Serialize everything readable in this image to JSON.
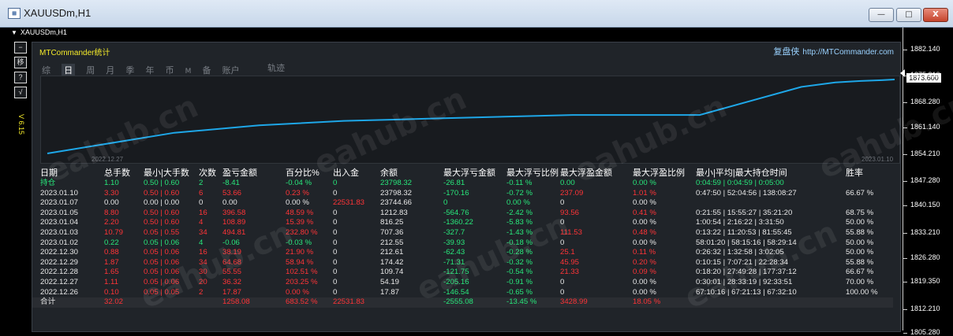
{
  "window": {
    "title": "XAUUSDm,H1",
    "minimize_label": "—",
    "maximize_label": "□",
    "close_label": "X"
  },
  "chart": {
    "symbol_tab": "XAUUSDm,H1",
    "current_price": "1873.600",
    "price_labels": [
      "1882.140",
      "1875.210",
      "1868.280",
      "1861.140",
      "1854.210",
      "1847.280",
      "1840.150",
      "1833.210",
      "1826.280",
      "1819.350",
      "1812.210",
      "1805.280"
    ],
    "left_buttons": [
      "−",
      "移",
      "?",
      "√"
    ],
    "version": "V 6.15"
  },
  "panel": {
    "title": "MTCommander统计",
    "brand_cn": "复盘侠",
    "brand_url": "http://MTCommander.com",
    "tabs": [
      "综",
      "日",
      "周",
      "月",
      "季",
      "年",
      "币",
      "M",
      "备",
      "账户"
    ],
    "active_tab": "日",
    "track_label": "轨迹",
    "equity_start_date": "2022.12.27",
    "equity_end_date": "2023.01.10",
    "equity_curve": [
      0,
      0.28,
      0.38,
      0.44,
      0.47,
      0.5,
      0.52,
      0.52,
      0.52,
      0.9,
      0.96,
      0.98,
      0.99,
      1.0
    ],
    "watermark": "eahub.cn"
  },
  "table": {
    "headers": [
      "日期",
      "总手数",
      "最小|大手数",
      "次数",
      "盈亏金额",
      "百分比%",
      "出入金",
      "余额",
      "最大浮亏金额",
      "最大浮亏比例",
      "最大浮盈金额",
      "最大浮盈比例",
      "最小|平均|最大持仓时间",
      "胜率"
    ],
    "rows": [
      {
        "date": "持仓",
        "lots": "1.10",
        "minmax": "0.50 | 0.60",
        "count": "2",
        "pnl": "-8.41",
        "pct": "-0.04 %",
        "dep": "0",
        "bal": "23798.32",
        "maxloss": "-26.81",
        "maxlosspct": "-0.11 %",
        "maxprofit": "0.00",
        "maxprofitpct": "0.00 %",
        "time": "0:04:59 | 0:04:59 | 0:05:00",
        "win": "",
        "cls": "first"
      },
      {
        "date": "2023.01.10",
        "lots": "3.30",
        "minmax": "0.50 | 0.60",
        "count": "6",
        "pnl": "53.66",
        "pct": "0.23 %",
        "dep": "0",
        "bal": "23798.32",
        "maxloss": "-170.16",
        "maxlosspct": "-0.72 %",
        "maxprofit": "237.09",
        "maxprofitpct": "1.01 %",
        "time": "0:47:50 | 52:04:56 | 138:08:27",
        "win": "66.67 %",
        "cls": "red"
      },
      {
        "date": "2023.01.07",
        "lots": "0.00",
        "minmax": "0.00 | 0.00",
        "count": "0",
        "pnl": "0.00",
        "pct": "0.00 %",
        "dep": "22531.83",
        "bal": "23744.66",
        "maxloss": "0",
        "maxlosspct": "0.00 %",
        "maxprofit": "0",
        "maxprofitpct": "0.00 %",
        "time": "",
        "win": "",
        "cls": "zero"
      },
      {
        "date": "2023.01.05",
        "lots": "8.80",
        "minmax": "0.50 | 0.60",
        "count": "16",
        "pnl": "396.58",
        "pct": "48.59 %",
        "dep": "0",
        "bal": "1212.83",
        "maxloss": "-564.76",
        "maxlosspct": "-2.42 %",
        "maxprofit": "93.56",
        "maxprofitpct": "0.41 %",
        "time": "0:21:55 | 15:55:27 | 35:21:20",
        "win": "68.75 %",
        "cls": "red"
      },
      {
        "date": "2023.01.04",
        "lots": "2.20",
        "minmax": "0.50 | 0.60",
        "count": "4",
        "pnl": "108.89",
        "pct": "15.39 %",
        "dep": "0",
        "bal": "816.25",
        "maxloss": "-1360.22",
        "maxlosspct": "-5.83 %",
        "maxprofit": "0",
        "maxprofitpct": "0.00 %",
        "time": "1:00:54 | 2:16:22 | 3:31:50",
        "win": "50.00 %",
        "cls": "red"
      },
      {
        "date": "2023.01.03",
        "lots": "10.79",
        "minmax": "0.05 | 0.55",
        "count": "34",
        "pnl": "494.81",
        "pct": "232.80 %",
        "dep": "0",
        "bal": "707.36",
        "maxloss": "-327.7",
        "maxlosspct": "-1.43 %",
        "maxprofit": "111.53",
        "maxprofitpct": "0.48 %",
        "time": "0:13:22 | 11:20:53 | 81:55:45",
        "win": "55.88 %",
        "cls": "red"
      },
      {
        "date": "2023.01.02",
        "lots": "0.22",
        "minmax": "0.05 | 0.06",
        "count": "4",
        "pnl": "-0.06",
        "pct": "-0.03 %",
        "dep": "0",
        "bal": "212.55",
        "maxloss": "-39.93",
        "maxlosspct": "-0.18 %",
        "maxprofit": "0",
        "maxprofitpct": "0.00 %",
        "time": "58:01:20 | 58:15:16 | 58:29:14",
        "win": "50.00 %",
        "cls": "green"
      },
      {
        "date": "2022.12.30",
        "lots": "0.88",
        "minmax": "0.05 | 0.06",
        "count": "16",
        "pnl": "38.19",
        "pct": "21.90 %",
        "dep": "0",
        "bal": "212.61",
        "maxloss": "-62.43",
        "maxlosspct": "-0.28 %",
        "maxprofit": "25.1",
        "maxprofitpct": "0.11 %",
        "time": "0:26:32 | 1:32:58 | 3:02:05",
        "win": "50.00 %",
        "cls": "red"
      },
      {
        "date": "2022.12.29",
        "lots": "1.87",
        "minmax": "0.05 | 0.06",
        "count": "34",
        "pnl": "64.68",
        "pct": "58.94 %",
        "dep": "0",
        "bal": "174.42",
        "maxloss": "-71.31",
        "maxlosspct": "-0.32 %",
        "maxprofit": "45.95",
        "maxprofitpct": "0.20 %",
        "time": "0:10:15 | 7:07:21 | 22:28:34",
        "win": "55.88 %",
        "cls": "red"
      },
      {
        "date": "2022.12.28",
        "lots": "1.65",
        "minmax": "0.05 | 0.06",
        "count": "30",
        "pnl": "55.55",
        "pct": "102.51 %",
        "dep": "0",
        "bal": "109.74",
        "maxloss": "-121.75",
        "maxlosspct": "-0.54 %",
        "maxprofit": "21.33",
        "maxprofitpct": "0.09 %",
        "time": "0:18:20 | 27:49:28 | 177:37:12",
        "win": "66.67 %",
        "cls": "red"
      },
      {
        "date": "2022.12.27",
        "lots": "1.11",
        "minmax": "0.05 | 0.06",
        "count": "20",
        "pnl": "36.32",
        "pct": "203.25 %",
        "dep": "0",
        "bal": "54.19",
        "maxloss": "-205.16",
        "maxlosspct": "-0.91 %",
        "maxprofit": "0",
        "maxprofitpct": "0.00 %",
        "time": "0:30:01 | 28:33:19 | 92:33:51",
        "win": "70.00 %",
        "cls": "red"
      },
      {
        "date": "2022.12.26",
        "lots": "0.10",
        "minmax": "0.05 | 0.05",
        "count": "2",
        "pnl": "17.87",
        "pct": "0.00 %",
        "dep": "0",
        "bal": "17.87",
        "maxloss": "-146.54",
        "maxlosspct": "-0.65 %",
        "maxprofit": "0",
        "maxprofitpct": "0.00 %",
        "time": "67:10:16 | 67:21:13 | 67:32:10",
        "win": "100.00 %",
        "cls": "red"
      }
    ],
    "total": {
      "date": "合计",
      "lots": "32.02",
      "minmax": "",
      "count": "",
      "pnl": "1258.08",
      "pct": "683.52 %",
      "dep": "22531.83",
      "bal": "",
      "maxloss": "-2555.08",
      "maxlosspct": "-13.45 %",
      "maxprofit": "3428.99",
      "maxprofitpct": "18.05 %",
      "time": "",
      "win": ""
    }
  },
  "colors": {
    "green": "#28e77b",
    "red": "#ff3437",
    "curve": "#1ea7e8",
    "yellow": "#f4ea2a"
  }
}
